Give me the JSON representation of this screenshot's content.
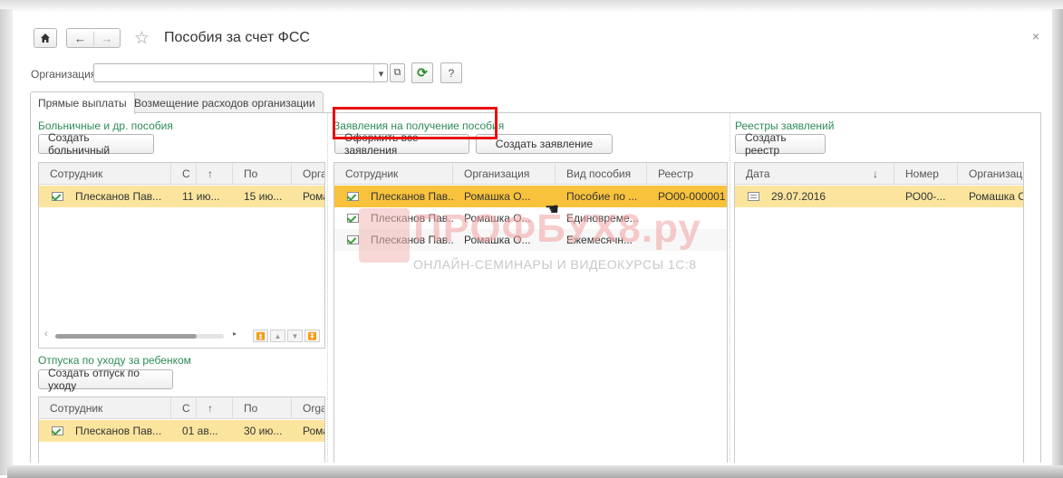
{
  "window": {
    "title": "Пособия за счет ФСС",
    "close_glyph": "×"
  },
  "toolbar": {
    "home_icon": "home-icon",
    "back_glyph": "←",
    "forward_glyph": "→",
    "star_glyph": "☆"
  },
  "organization": {
    "label": "Организация:",
    "value": "",
    "dropdown_glyph": "▾",
    "open_glyph": "⧉",
    "refresh_glyph": "⟳",
    "help_label": "?"
  },
  "tabs": [
    {
      "label": "Прямые выплаты",
      "active": true
    },
    {
      "label": "Возмещение расходов организации",
      "active": false
    }
  ],
  "sick_leave": {
    "title": "Больничные и др. пособия",
    "create_button": "Создать больничный",
    "columns": [
      "Сотрудник",
      "С",
      "↑",
      "По",
      "Орга"
    ],
    "rows": [
      {
        "employee": "Плесканов Пав...",
        "from": "11 ию...",
        "to": "15 ию...",
        "org": "Рома"
      }
    ],
    "scroll_left": "‹",
    "scroll_right": "▸",
    "nav_buttons": [
      "⏫",
      "▲",
      "▼",
      "⏬"
    ]
  },
  "parental_leave": {
    "title": "Отпуска по уходу за ребенком",
    "create_button": "Создать отпуск по уходу",
    "columns": [
      "Сотрудник",
      "С",
      "↑",
      "По",
      "Orga"
    ],
    "rows": [
      {
        "employee": "Плесканов Пав...",
        "from": "01 ав...",
        "to": "30 ию...",
        "org": "Рома"
      }
    ]
  },
  "applications": {
    "title": "Заявления на получение пособия",
    "issue_all_button": "Оформить все заявления",
    "create_button": "Создать заявление",
    "columns": [
      "Сотрудник",
      "Организация",
      "Вид пособия",
      "Реестр"
    ],
    "rows": [
      {
        "employee": "Плесканов Пав...",
        "org": "Ромашка О...",
        "type": "Пособие по ...",
        "registry": "РО00-000001"
      },
      {
        "employee": "Плесканов Пав...",
        "org": "Ромашка О...",
        "type": "Единовреме...",
        "registry": ""
      },
      {
        "employee": "Плесканов Пав...",
        "org": "Ромашка О...",
        "type": "Ежемесячн...",
        "registry": ""
      }
    ]
  },
  "registries": {
    "title": "Реестры заявлений",
    "create_button": "Создать реестр",
    "columns": [
      "Дата",
      "↓",
      "Номер",
      "Организаци"
    ],
    "rows": [
      {
        "date": "29.07.2016",
        "number": "РО00-...",
        "org": "Ромашка О"
      }
    ]
  },
  "watermark": {
    "brand": "ПРОФБУХ8.ру",
    "tagline": "ОНЛАЙН-СЕМИНАРЫ И ВИДЕОКУРСЫ 1С:8"
  },
  "colors": {
    "accent_green": "#2e8b57",
    "selected_row": "#fbe59e",
    "active_row": "#f9c23c",
    "highlight_box": "#e8100e"
  }
}
